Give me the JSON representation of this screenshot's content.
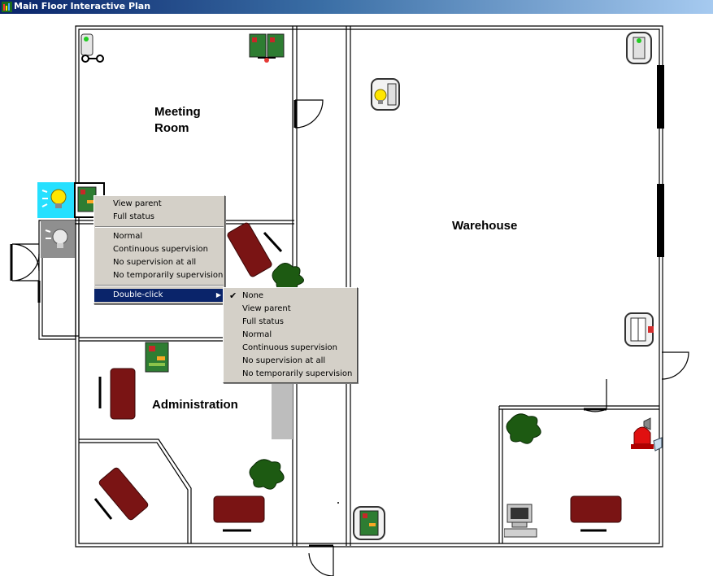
{
  "window": {
    "title": "Main Floor Interactive Plan"
  },
  "rooms": {
    "meeting_room": "Meeting\nRoom",
    "warehouse": "Warehouse",
    "administration": "Administration"
  },
  "context_menu": {
    "items": [
      "View parent",
      "Full status"
    ],
    "supervision_items": [
      "Normal",
      "Continuous supervision",
      "No supervision at all",
      "No temporarily supervision"
    ],
    "submenu_trigger": "Double-click"
  },
  "submenu": {
    "checked_item": "None",
    "items": [
      "View parent",
      "Full status",
      "Normal",
      "Continuous supervision",
      "No supervision at all",
      "No temporarily supervision"
    ]
  },
  "colors": {
    "furniture": "#7a1414",
    "plant": "#1d5a12",
    "highlight": "#0a246a",
    "menu_bg": "#d4d0c8"
  },
  "icons": [
    "app-icon",
    "lamp-on-icon",
    "lamp-off-icon",
    "control-panel-icon",
    "camera-icon",
    "reader-icon",
    "light-switch-icon",
    "door-contact-icon",
    "siren-icon",
    "computer-icon",
    "plant-icon"
  ]
}
